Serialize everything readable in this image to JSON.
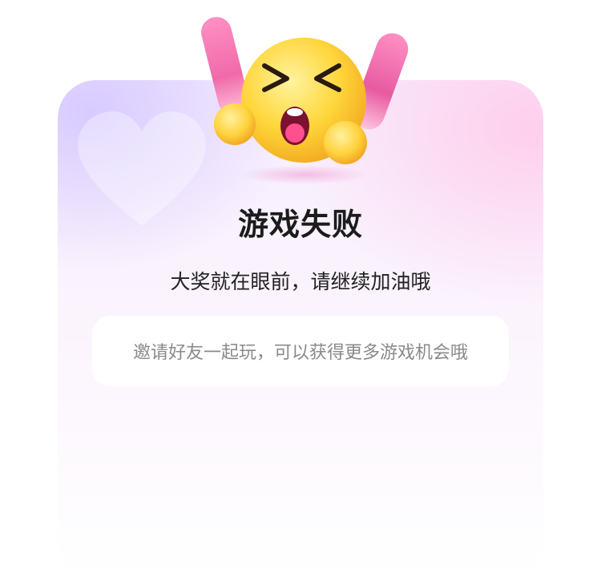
{
  "dialog": {
    "title": "游戏失败",
    "message": "大奖就在眼前，请继续加油哦",
    "hint": "邀请好友一起玩，可以获得更多游戏机会哦"
  },
  "icons": {
    "illustration": "frustrated-emoji-icon"
  },
  "colors": {
    "title_text": "#1b1b1b",
    "hint_text": "#8a8a8a",
    "card_top_left": "#d6c8ff",
    "card_top_right": "#ffcdeb",
    "emoji_face": "#ffd53a",
    "exclamation_bar": "#ff7fb8"
  }
}
